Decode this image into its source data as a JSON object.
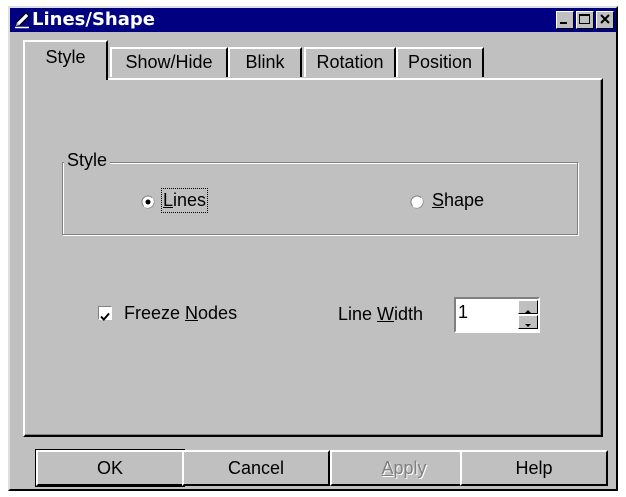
{
  "window": {
    "title": "Lines/Shape",
    "icon": "pencil-icon"
  },
  "tabs": [
    {
      "label": "Style",
      "active": true
    },
    {
      "label": "Show/Hide",
      "active": false
    },
    {
      "label": "Blink",
      "active": false
    },
    {
      "label": "Rotation",
      "active": false
    },
    {
      "label": "Position",
      "active": false
    }
  ],
  "style_group": {
    "label": "Style",
    "options": [
      {
        "label_pre": "",
        "label_mnemonic": "L",
        "label_post": "ines",
        "selected": true
      },
      {
        "label_pre": "",
        "label_mnemonic": "S",
        "label_post": "hape",
        "selected": false
      }
    ]
  },
  "freeze_nodes": {
    "label_pre": "Freeze ",
    "label_mnemonic": "N",
    "label_post": "odes",
    "checked": true
  },
  "line_width": {
    "label_pre": "Line ",
    "label_mnemonic": "W",
    "label_post": "idth",
    "value": "1"
  },
  "buttons": {
    "ok": "OK",
    "cancel": "Cancel",
    "apply_mnemonic": "A",
    "apply_post": "pply",
    "help": "Help"
  }
}
